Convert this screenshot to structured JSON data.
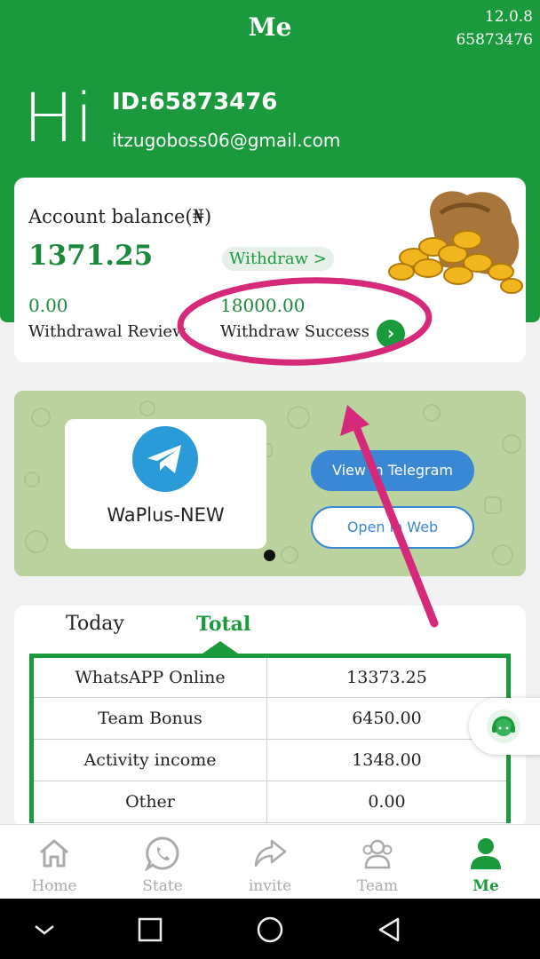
{
  "header": {
    "title": "Me",
    "version": "12.0.8",
    "version_id": "65873476",
    "greeting": "Hi",
    "user_id": "ID:65873476",
    "email": "itzugoboss06@gmail.com"
  },
  "balance": {
    "label": "Account balance(₦)",
    "value": "1371.25",
    "withdraw_label": "Withdraw >",
    "review_amount": "0.00",
    "review_label": "Withdrawal Review",
    "success_amount": "18000.00",
    "success_label": "Withdraw Success"
  },
  "banner": {
    "app_name": "WaPlus-NEW",
    "view_button": "View in Telegram",
    "open_button": "Open in Web"
  },
  "stats": {
    "tabs": [
      "Today",
      "Total"
    ],
    "active_tab": "Total",
    "rows": [
      {
        "label": "WhatsAPP Online",
        "value": "13373.25"
      },
      {
        "label": "Team Bonus",
        "value": "6450.00"
      },
      {
        "label": "Activity income",
        "value": "1348.00"
      },
      {
        "label": "Other",
        "value": "0.00"
      }
    ]
  },
  "tabbar": {
    "items": [
      {
        "label": "Home",
        "icon": "home-icon"
      },
      {
        "label": "State",
        "icon": "whatsapp-icon"
      },
      {
        "label": "invite",
        "icon": "share-icon"
      },
      {
        "label": "Team",
        "icon": "team-icon"
      },
      {
        "label": "Me",
        "icon": "person-icon"
      }
    ],
    "active": "Me"
  },
  "colors": {
    "brand_green": "#1a9a3c",
    "annotation_pink": "#d6297a",
    "telegram_blue": "#2a9bd8"
  }
}
